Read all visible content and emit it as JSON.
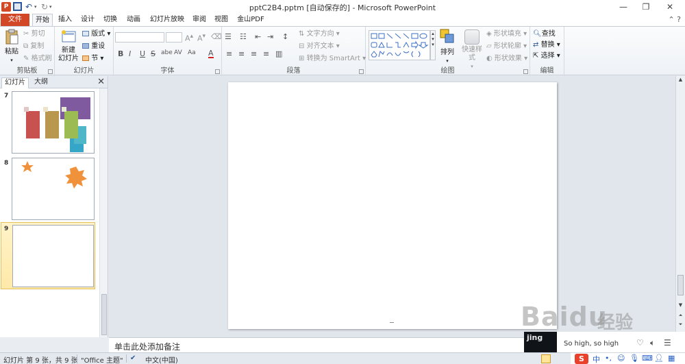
{
  "window": {
    "title": "pptC2B4.pptm [自动保存的] - Microsoft PowerPoint",
    "app_icon_letter": "P",
    "minimize": "—",
    "restore": "❐",
    "close": "✕"
  },
  "tabs": [
    {
      "label": "文件"
    },
    {
      "label": "开始"
    },
    {
      "label": "插入"
    },
    {
      "label": "设计"
    },
    {
      "label": "切换"
    },
    {
      "label": "动画"
    },
    {
      "label": "幻灯片放映"
    },
    {
      "label": "审阅"
    },
    {
      "label": "视图"
    },
    {
      "label": "金山PDF"
    }
  ],
  "ribbon": {
    "clipboard": {
      "label": "剪贴板",
      "paste": "粘贴",
      "cut": "剪切",
      "copy": "复制",
      "format_painter": "格式刷"
    },
    "slides": {
      "label": "幻灯片",
      "new_slide": "新建",
      "new_slide_line2": "幻灯片",
      "layout": "版式",
      "reset": "重设",
      "section": "节"
    },
    "font": {
      "label": "字体",
      "bold": "B",
      "italic": "I",
      "underline": "U",
      "strike": "S",
      "shadow": "abe",
      "spacing": "AV",
      "case": "Aa",
      "color": "A"
    },
    "paragraph": {
      "label": "段落",
      "text_direction": "文字方向",
      "align_text": "对齐文本",
      "smartart": "转换为 SmartArt"
    },
    "drawing": {
      "label": "绘图",
      "arrange": "排列",
      "quick_styles": "快速样式",
      "shape_fill": "形状填充",
      "shape_outline": "形状轮廓",
      "shape_effects": "形状效果"
    },
    "editing": {
      "label": "编辑",
      "find": "查找",
      "replace": "替换",
      "select": "选择"
    }
  },
  "panel": {
    "tab_slides": "幻灯片",
    "tab_outline": "大纲",
    "close": "✕",
    "thumbnails": [
      {
        "number": "7"
      },
      {
        "number": "8"
      },
      {
        "number": "9"
      }
    ]
  },
  "notes": {
    "placeholder": "单击此处添加备注"
  },
  "status": {
    "slide_info": "幻灯片 第 9 张，共 9 张",
    "theme": "\"Office 主题\"",
    "language": "中文(中国)"
  },
  "player": {
    "album_text": "jing",
    "song": "So high, so high"
  },
  "ime": {
    "brand": "S",
    "mode": "中"
  },
  "watermark": {
    "text": "Baidu",
    "sub": "经验"
  }
}
